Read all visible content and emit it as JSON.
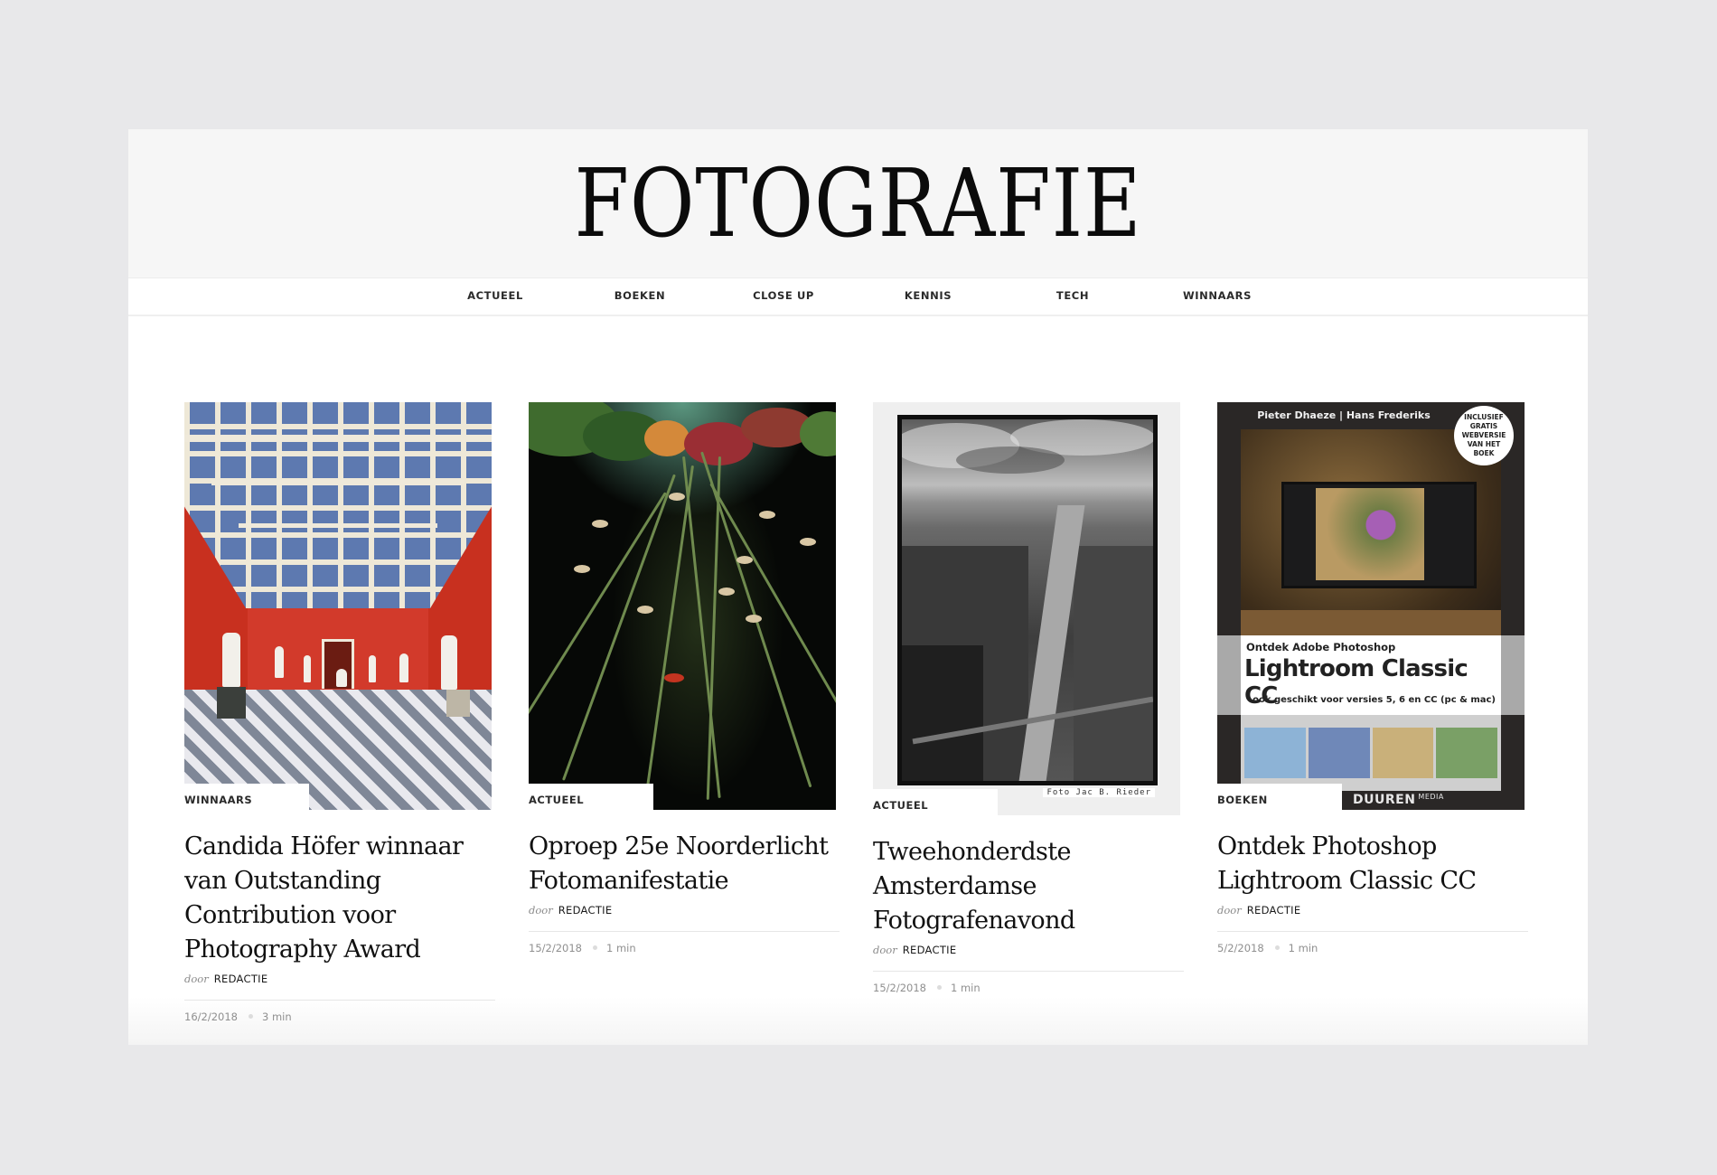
{
  "site": {
    "title": "FOTOGRAFIE"
  },
  "nav": {
    "items": [
      {
        "label": "ACTUEEL"
      },
      {
        "label": "BOEKEN"
      },
      {
        "label": "CLOSE UP"
      },
      {
        "label": "KENNIS"
      },
      {
        "label": "TECH"
      },
      {
        "label": "WINNAARS"
      }
    ]
  },
  "articles": [
    {
      "category": "WINNAARS",
      "title": "Candida Höfer winnaar van Outstanding Contribution voor Photography Award",
      "by_prefix": "door",
      "author": "REDACTIE",
      "date": "16/2/2018",
      "read_time": "3 min",
      "image": "red-gallery-hall-with-statues"
    },
    {
      "category": "ACTUEEL",
      "title": "Oproep 25e Noorderlicht Fotomanifestatie",
      "by_prefix": "door",
      "author": "REDACTIE",
      "date": "15/2/2018",
      "read_time": "1 min",
      "image": "underwater-water-lilies"
    },
    {
      "category": "ACTUEEL",
      "title": "Tweehonderdste Amsterdamse Fotografenavond",
      "by_prefix": "door",
      "author": "REDACTIE",
      "date": "15/2/2018",
      "read_time": "1 min",
      "image": "black-and-white-amsterdam-canal",
      "image_credit": "Foto Jac B. Rieder"
    },
    {
      "category": "BOEKEN",
      "title": "Ontdek Photoshop Lightroom Classic CC",
      "by_prefix": "door",
      "author": "REDACTIE",
      "date": "5/2/2018",
      "read_time": "1 min",
      "image": "book-cover-lightroom",
      "book_cover": {
        "authors": "Pieter Dhaeze | Hans Frederiks",
        "badge": "INCLUSIEF\nGRATIS\nWEBVERSIE\nVAN HET\nBOEK",
        "line1": "Ontdek Adobe Photoshop",
        "line2": "Lightroom Classic CC",
        "line3": "ook geschikt voor versies 5, 6 en CC (pc & mac)",
        "publisher": "DUUREN",
        "publisher_suffix": "MEDIA"
      }
    }
  ],
  "colors": {
    "page_bg": "#e8e8ea",
    "masthead_bg": "#f6f6f6",
    "text": "#111111",
    "muted": "#8f8f8f"
  }
}
